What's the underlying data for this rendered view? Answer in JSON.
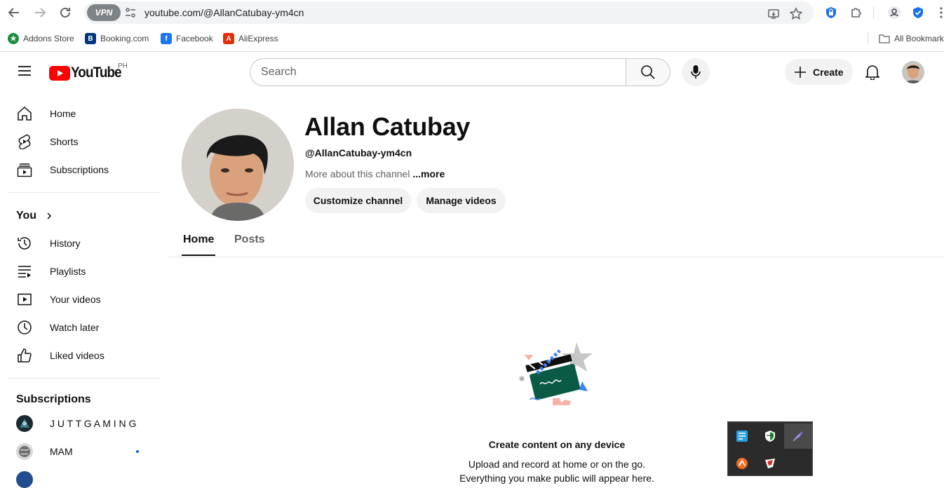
{
  "browser": {
    "vpn_label": "VPN",
    "url": "youtube.com/@AllanCatubay-ym4cn",
    "bookmarks": [
      {
        "label": "Addons Store",
        "icon": "addons-store-icon",
        "color": "#1e8e3e"
      },
      {
        "label": "Booking.com",
        "icon": "booking-icon",
        "color": "#003580"
      },
      {
        "label": "Facebook",
        "icon": "facebook-icon",
        "color": "#1877f2"
      },
      {
        "label": "AliExpress",
        "icon": "aliexpress-icon",
        "color": "#e62e04"
      }
    ],
    "all_bookmarks": "All Bookmark"
  },
  "header": {
    "logo_text": "YouTube",
    "country": "PH",
    "search_placeholder": "Search",
    "create_label": "Create"
  },
  "sidebar": {
    "main": [
      {
        "label": "Home",
        "icon": "home-icon"
      },
      {
        "label": "Shorts",
        "icon": "shorts-icon"
      },
      {
        "label": "Subscriptions",
        "icon": "subscriptions-icon"
      }
    ],
    "you_heading": "You",
    "you": [
      {
        "label": "History",
        "icon": "history-icon"
      },
      {
        "label": "Playlists",
        "icon": "playlists-icon"
      },
      {
        "label": "Your videos",
        "icon": "your-videos-icon"
      },
      {
        "label": "Watch later",
        "icon": "watch-later-icon"
      },
      {
        "label": "Liked videos",
        "icon": "liked-videos-icon"
      }
    ],
    "subscriptions_heading": "Subscriptions",
    "subscriptions": [
      {
        "label": "J U T T G A M I N G",
        "new": false
      },
      {
        "label": "MAM",
        "new": true
      }
    ]
  },
  "channel": {
    "name": "Allan Catubay",
    "handle": "@AllanCatubay-ym4cn",
    "about": "More about this channel",
    "more": "...more",
    "customize_label": "Customize channel",
    "manage_label": "Manage videos",
    "tabs": [
      "Home",
      "Posts"
    ],
    "active_tab": "Home"
  },
  "empty_state": {
    "title": "Create content on any device",
    "subtitle": "Upload and record at home or on the go.",
    "subtitle2": "Everything you make public will appear here."
  },
  "colors": {
    "yt_red": "#ff0000",
    "accent_blue": "#065fd4"
  }
}
